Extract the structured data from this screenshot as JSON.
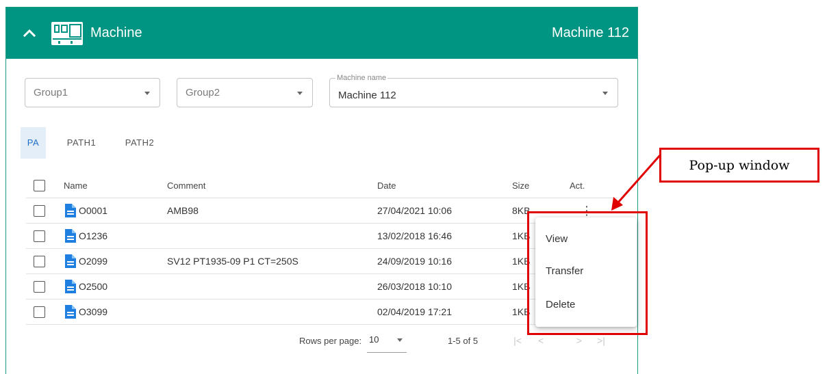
{
  "header": {
    "collapse_icon": "chevron-up-icon",
    "machine_icon": "machine-icon",
    "title": "Machine",
    "machine_label": "Machine 112"
  },
  "filters": {
    "group1": {
      "value": "Group1"
    },
    "group2": {
      "value": "Group2"
    },
    "machine_name": {
      "legend": "Machine name",
      "value": "Machine 112"
    }
  },
  "tabs": [
    {
      "label": "PA",
      "active": true
    },
    {
      "label": "PATH1",
      "active": false
    },
    {
      "label": "PATH2",
      "active": false
    }
  ],
  "table": {
    "columns": {
      "name": "Name",
      "comment": "Comment",
      "date": "Date",
      "size": "Size",
      "act": "Act."
    },
    "rows": [
      {
        "name": "O0001",
        "comment": "AMB98",
        "date": "27/04/2021 10:06",
        "size": "8KB"
      },
      {
        "name": "O1236",
        "comment": "",
        "date": "13/02/2018 16:46",
        "size": "1KB"
      },
      {
        "name": "O2099",
        "comment": "SV12 PT1935-09 P1 CT=250S",
        "date": "24/09/2019 10:16",
        "size": "1KB"
      },
      {
        "name": "O2500",
        "comment": "",
        "date": "26/03/2018 10:10",
        "size": "1KB"
      },
      {
        "name": "O3099",
        "comment": "",
        "date": "02/04/2019 17:21",
        "size": "1KB"
      }
    ],
    "row_icon": "document-icon",
    "action_icon": "more-vert-icon"
  },
  "pagination": {
    "rows_per_page_label": "Rows per page:",
    "rows_per_page_value": "10",
    "range": "1-5 of 5",
    "first_icon": "first-page-icon",
    "prev_icon": "chevron-left-icon",
    "next_icon": "chevron-right-icon",
    "last_icon": "last-page-icon"
  },
  "popup_menu": {
    "items": [
      "View",
      "Transfer",
      "Delete"
    ]
  },
  "annotation": {
    "callout": "Pop-up window"
  },
  "colors": {
    "header": "#009582",
    "accent_blue": "#1f6fc7",
    "annotation_red": "#e00000"
  }
}
